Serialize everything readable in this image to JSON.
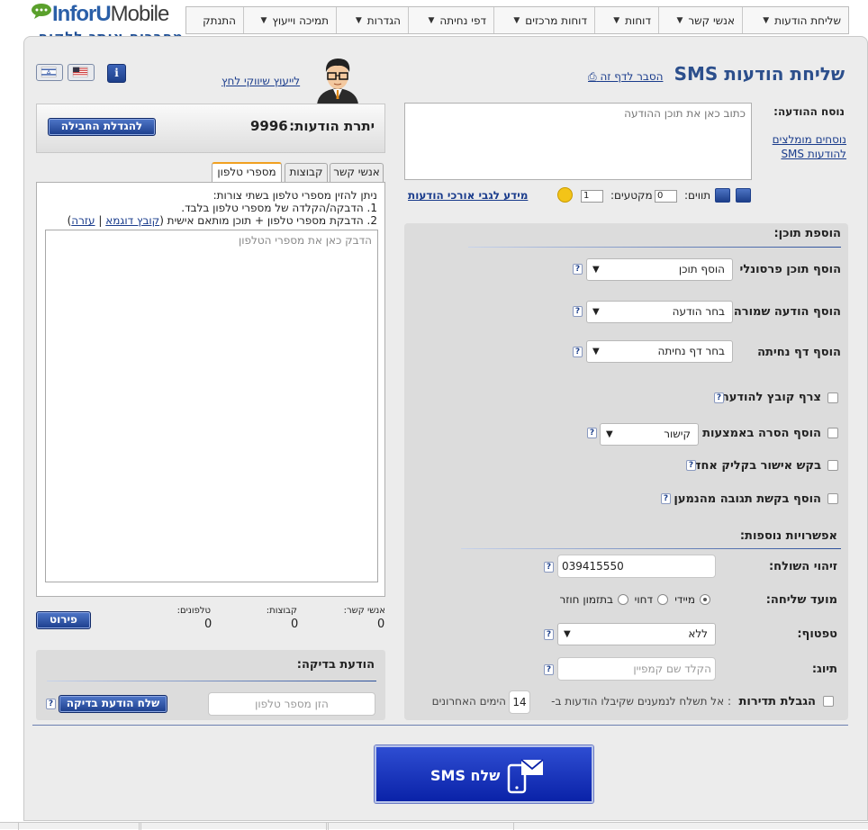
{
  "logo": {
    "brand_a": "InforU",
    "brand_b": "Mobile",
    "tagline": "מחברים אותך ללקוח"
  },
  "nav": [
    {
      "label": "שליחת הודעות"
    },
    {
      "label": "אנשי קשר"
    },
    {
      "label": "דוחות"
    },
    {
      "label": "דוחות מרכזים"
    },
    {
      "label": "דפי נחיתה"
    },
    {
      "label": "הגדרות"
    },
    {
      "label": "תמיכה וייעוץ"
    },
    {
      "label": "התנתק"
    }
  ],
  "header": {
    "title": "שליחת הודעות SMS",
    "explain_link": "הסבר לדף זה",
    "consult_link": "לייעוץ שיווקי לחץ",
    "info_label": "i"
  },
  "message": {
    "label": "נוסח ההודעה:",
    "placeholder": "כתוב כאן את תוכן ההודעה",
    "recommended_link": "נוסחים מומלצים להודעות SMS",
    "chars_label": "תווים:",
    "chars_value": "0",
    "segments_label": "מקטעים:",
    "segments_value": "1",
    "long_msg_link": "מידע לגבי אורכי הודעות"
  },
  "add_content": {
    "heading": "הוספת תוכן:",
    "personal_label": "הוסף תוכן פרסונלי",
    "personal_value": "הוסף תוכן",
    "saved_label": "הוסף הודעה שמורה",
    "saved_value": "בחר הודעה",
    "landing_label": "הוסף דף נחיתה",
    "landing_value": "בחר דף נחיתה",
    "attach_label": "צרף קובץ להודעה",
    "unsubscribe_label": "הוסף הסרה באמצעות",
    "unsubscribe_value": "קישור",
    "one_click_label": "בקש אישור בקליק אחד",
    "response_label": "הוסף בקשת תגובה מהנמען"
  },
  "options": {
    "heading": "אפשרויות נוספות:",
    "sender_label": "זיהוי השולח:",
    "sender_value": "039415550",
    "timing_label": "מועד שליחה:",
    "timing_now": "מיידי",
    "timing_later": "דחוי",
    "timing_recurring": "בתזמון חוזר",
    "template_label": "טפטוף:",
    "template_value": "ללא",
    "tag_label": "תיוג:",
    "tag_placeholder": "הקלד שם קמפיין",
    "freq_label": "הגבלת תדירות",
    "freq_text_a": ": אל תשלח לנמענים שקיבלו הודעות ב-",
    "freq_days": "14",
    "freq_text_b": "הימים האחרונים"
  },
  "balance": {
    "label": "יתרת הודעות:",
    "value": "9996",
    "upgrade_button": "להגדלת החבילה"
  },
  "tabs": [
    {
      "label": "אנשי קשר"
    },
    {
      "label": "קבוצות"
    },
    {
      "label": "מספרי טלפון"
    }
  ],
  "phones": {
    "instr_1": "ניתן להזין מספרי טלפון בשתי צורות:",
    "instr_2": "1. הדבקה/הקלדה של מספרי טלפון בלבד.",
    "instr_3": "2. הדבקת מספרי טלפון + תוכן מותאם אישית (",
    "sample_link": "קובץ דוגמא",
    "sep": "|",
    "help_link": "עזרה",
    "close_paren": ")",
    "placeholder": "הדבק כאן את מספרי הטלפון"
  },
  "stats": {
    "contacts_label": "אנשי קשר:",
    "contacts_value": "0",
    "groups_label": "קבוצות:",
    "groups_value": "0",
    "phones_label": "טלפונים:",
    "phones_value": "0",
    "details_button": "פירוט"
  },
  "test": {
    "heading": "הודעת בדיקה:",
    "placeholder": "הזן מספר טלפון",
    "send_button": "שלח הודעת בדיקה"
  },
  "send": {
    "label": "שלח SMS"
  },
  "help_glyph": "?",
  "colors": {
    "primary": "#1d3f8a",
    "send": "#0a22a8",
    "title": "#2c4f8c"
  }
}
